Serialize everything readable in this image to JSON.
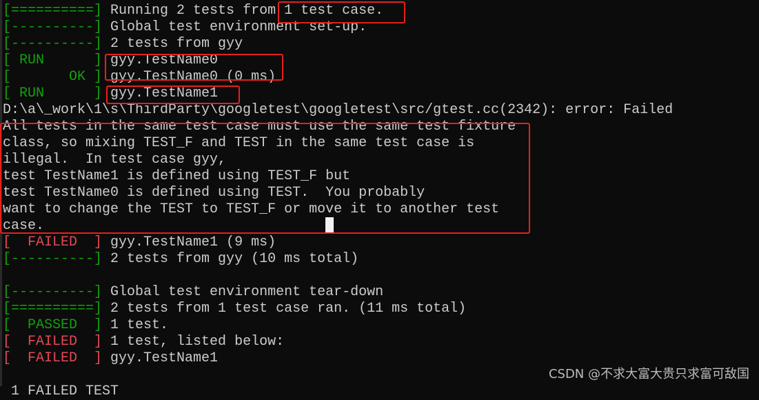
{
  "colors": {
    "green": "#16c60c",
    "bracket_green": "#13a10e",
    "red": "#e74856",
    "text": "#cccccc",
    "highlight": "#e8201c"
  },
  "lines": [
    {
      "tag": "[==========]",
      "tag_color": "green",
      "text": " Running 2 tests from 1 test case."
    },
    {
      "tag": "[----------]",
      "tag_color": "green",
      "text": " Global test environment set-up."
    },
    {
      "tag": "[----------]",
      "tag_color": "green",
      "text": " 2 tests from gyy"
    },
    {
      "tag": "[ RUN      ]",
      "tag_color": "green",
      "text": " gyy.TestName0"
    },
    {
      "tag": "[       OK ]",
      "tag_color": "green",
      "text": " gyy.TestName0 (0 ms)"
    },
    {
      "tag": "[ RUN      ]",
      "tag_color": "green",
      "text": " gyy.TestName1"
    },
    {
      "tag": "",
      "tag_color": "",
      "text": "D:\\a\\_work\\1\\s\\ThirdParty\\googletest\\googletest\\src/gtest.cc(2342): error: Failed"
    },
    {
      "tag": "",
      "tag_color": "",
      "text": "All tests in the same test case must use the same test fixture"
    },
    {
      "tag": "",
      "tag_color": "",
      "text": "class, so mixing TEST_F and TEST in the same test case is"
    },
    {
      "tag": "",
      "tag_color": "",
      "text": "illegal.  In test case gyy,"
    },
    {
      "tag": "",
      "tag_color": "",
      "text": "test TestName1 is defined using TEST_F but"
    },
    {
      "tag": "",
      "tag_color": "",
      "text": "test TestName0 is defined using TEST.  You probably"
    },
    {
      "tag": "",
      "tag_color": "",
      "text": "want to change the TEST to TEST_F or move it to another test"
    },
    {
      "tag": "",
      "tag_color": "",
      "text": "case."
    },
    {
      "tag": "[  FAILED  ]",
      "tag_color": "red",
      "text": " gyy.TestName1 (9 ms)"
    },
    {
      "tag": "[----------]",
      "tag_color": "green",
      "text": " 2 tests from gyy (10 ms total)"
    },
    {
      "tag": "",
      "tag_color": "",
      "text": ""
    },
    {
      "tag": "[----------]",
      "tag_color": "green",
      "text": " Global test environment tear-down"
    },
    {
      "tag": "[==========]",
      "tag_color": "green",
      "text": " 2 tests from 1 test case ran. (11 ms total)"
    },
    {
      "tag": "[  PASSED  ]",
      "tag_color": "green",
      "text": " 1 test."
    },
    {
      "tag": "[  FAILED  ]",
      "tag_color": "red",
      "text": " 1 test, listed below:"
    },
    {
      "tag": "[  FAILED  ]",
      "tag_color": "red",
      "text": " gyy.TestName1"
    },
    {
      "tag": "",
      "tag_color": "",
      "text": ""
    },
    {
      "tag": "",
      "tag_color": "",
      "text": " 1 FAILED TEST"
    }
  ],
  "watermark": "CSDN @不求大富大贵只求富可敌国"
}
